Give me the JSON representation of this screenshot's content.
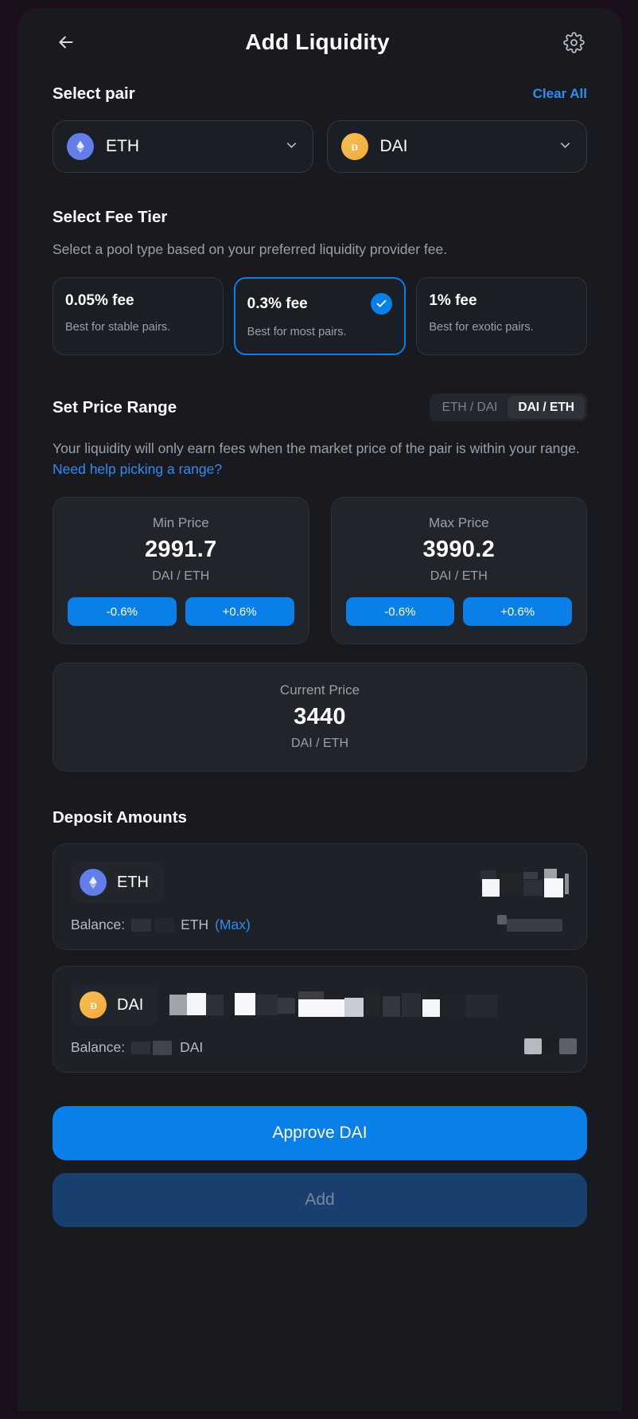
{
  "header": {
    "back_icon": "arrow-left-icon",
    "title": "Add Liquidity",
    "settings_icon": "gear-icon"
  },
  "select_pair": {
    "title": "Select pair",
    "clear_all": "Clear All",
    "tokens": [
      {
        "symbol": "ETH",
        "icon": "ethereum-coin-icon",
        "color": "#627eea",
        "chevron": "chevron-down-icon"
      },
      {
        "symbol": "DAI",
        "icon": "dai-coin-icon",
        "color": "#f2a93b",
        "chevron": "chevron-down-icon"
      }
    ]
  },
  "fee_tier": {
    "title": "Select Fee Tier",
    "description": "Select a pool type based on your preferred liquidity provider fee.",
    "options": [
      {
        "pct": "0.05% fee",
        "sub": "Best for stable pairs.",
        "selected": false
      },
      {
        "pct": "0.3% fee",
        "sub": "Best for most pairs.",
        "selected": true
      },
      {
        "pct": "1% fee",
        "sub": "Best for exotic pairs.",
        "selected": false
      }
    ],
    "selected_icon": "check-circle-icon",
    "accent": "#0b7fe8"
  },
  "price_range": {
    "title": "Set Price Range",
    "toggle": {
      "left": "ETH / DAI",
      "right": "DAI / ETH",
      "active": "right"
    },
    "description_part1": "Your liquidity will only earn fees when the market price of the pair is within your range. ",
    "help_link": "Need help picking a range?",
    "min": {
      "label": "Min Price",
      "value": "2991.7",
      "pair": "DAI / ETH",
      "dec": "-0.6%",
      "inc": "+0.6%"
    },
    "max": {
      "label": "Max Price",
      "value": "3990.2",
      "pair": "DAI / ETH",
      "dec": "-0.6%",
      "inc": "+0.6%"
    },
    "current": {
      "label": "Current Price",
      "value": "3440",
      "pair": "DAI / ETH"
    }
  },
  "deposit": {
    "title": "Deposit Amounts",
    "rows": [
      {
        "symbol": "ETH",
        "icon": "ethereum-coin-icon",
        "amount": "",
        "balance_label": "Balance:",
        "balance_value": "",
        "balance_symbol": "ETH",
        "max_label": "(Max)",
        "fiat": ""
      },
      {
        "symbol": "DAI",
        "icon": "dai-coin-icon",
        "amount": "",
        "balance_label": "Balance:",
        "balance_value": "",
        "balance_symbol": "DAI",
        "max_label": "",
        "fiat": ""
      }
    ]
  },
  "actions": {
    "approve_label": "Approve DAI",
    "add_label": "Add"
  }
}
